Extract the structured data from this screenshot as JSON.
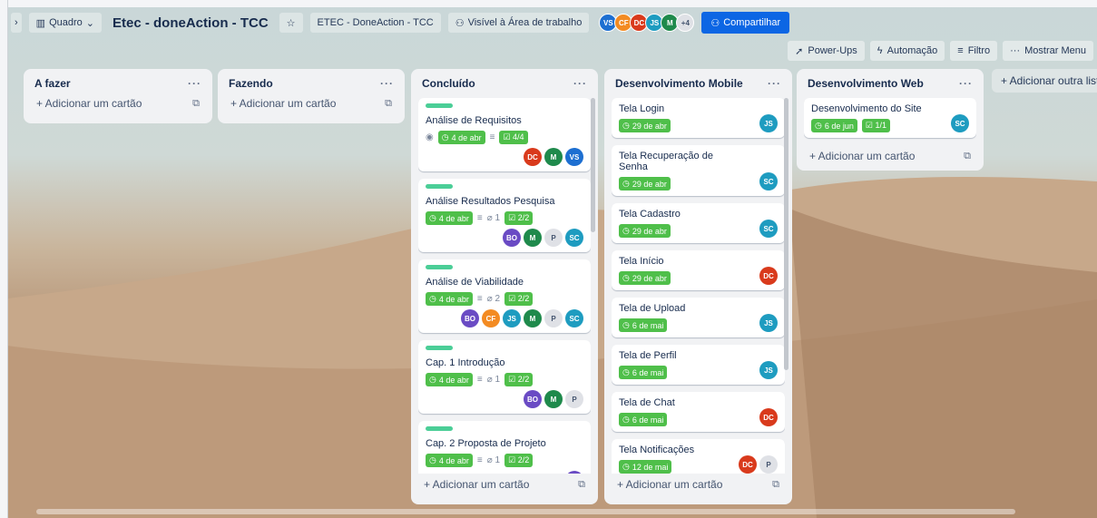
{
  "header": {
    "view_switch": "Quadro",
    "board_title": "Etec - doneAction - TCC",
    "workspace": "ETEC - DoneAction - TCC",
    "visibility": "Visível à Área de trabalho",
    "avatars": [
      {
        "initials": "VS",
        "color": "#1d6fd1"
      },
      {
        "initials": "CF",
        "color": "#f38b22"
      },
      {
        "initials": "DC",
        "color": "#d93a1c"
      },
      {
        "initials": "JS",
        "color": "#1e9cc0"
      },
      {
        "initials": "M",
        "color": "#1f8a4c"
      }
    ],
    "more_members": "+4",
    "share": "Compartilhar"
  },
  "toolbar": {
    "powerups": "Power-Ups",
    "automation": "Automação",
    "filter": "Filtro",
    "show_menu": "Mostrar Menu"
  },
  "lists": {
    "todo": {
      "title": "A fazer",
      "add": "+ Adicionar um cartão"
    },
    "doing": {
      "title": "Fazendo",
      "add": "+ Adicionar um cartão"
    },
    "done": {
      "title": "Concluído",
      "add": "+ Adicionar um cartão",
      "cards": [
        {
          "title": "Análise de Requisitos",
          "due": "4 de abr",
          "checklist": "4/4",
          "members": [
            "DC",
            "M",
            "VS"
          ]
        },
        {
          "title": "Análise Resultados Pesquisa",
          "due": "4 de abr",
          "attachments": "1",
          "checklist": "2/2",
          "members": [
            "BO",
            "M",
            "P",
            "SC"
          ]
        },
        {
          "title": "Análise de Viabilidade",
          "due": "4 de abr",
          "attachments": "2",
          "checklist": "2/2",
          "members": [
            "BO",
            "CF",
            "JS",
            "M",
            "P",
            "SC"
          ]
        },
        {
          "title": "Cap. 1 Introdução",
          "due": "4 de abr",
          "attachments": "1",
          "checklist": "2/2",
          "members": [
            "BO",
            "M",
            "P"
          ]
        },
        {
          "title": "Cap. 2 Proposta de Projeto",
          "due": "4 de abr",
          "attachments": "1",
          "checklist": "2/2",
          "members": [
            "BO"
          ]
        }
      ]
    },
    "mobile": {
      "title": "Desenvolvimento Mobile",
      "add": "+ Adicionar um cartão",
      "cards": [
        {
          "title": "Tela Login",
          "due": "29 de abr",
          "members": [
            "JS"
          ]
        },
        {
          "title": "Tela Recuperação de Senha",
          "due": "29 de abr",
          "members": [
            "SC"
          ]
        },
        {
          "title": "Tela Cadastro",
          "due": "29 de abr",
          "members": [
            "SC"
          ]
        },
        {
          "title": "Tela Início",
          "due": "29 de abr",
          "members": [
            "DC"
          ]
        },
        {
          "title": "Tela de Upload",
          "due": "6 de mai",
          "members": [
            "JS"
          ]
        },
        {
          "title": "Tela de Perfil",
          "due": "6 de mai",
          "members": [
            "JS"
          ]
        },
        {
          "title": "Tela de Chat",
          "due": "6 de mai",
          "members": [
            "DC"
          ]
        },
        {
          "title": "Tela Notificações",
          "due": "12 de mai",
          "members": [
            "DC",
            "P"
          ]
        }
      ]
    },
    "web": {
      "title": "Desenvolvimento Web",
      "add": "+ Adicionar um cartão",
      "cards": [
        {
          "title": "Desenvolvimento do Site",
          "due": "6 de jun",
          "checklist": "1/1",
          "members": [
            "SC"
          ]
        }
      ]
    }
  },
  "add_list": "+ Adicionar outra lista",
  "member_colors": {
    "DC": "#d93a1c",
    "M": "#1f8a4c",
    "VS": "#1d6fd1",
    "BO": "#6a4bc4",
    "P": "#dfe1e6",
    "SC": "#1e9cc0",
    "CF": "#f38b22",
    "JS": "#1e9cc0"
  }
}
